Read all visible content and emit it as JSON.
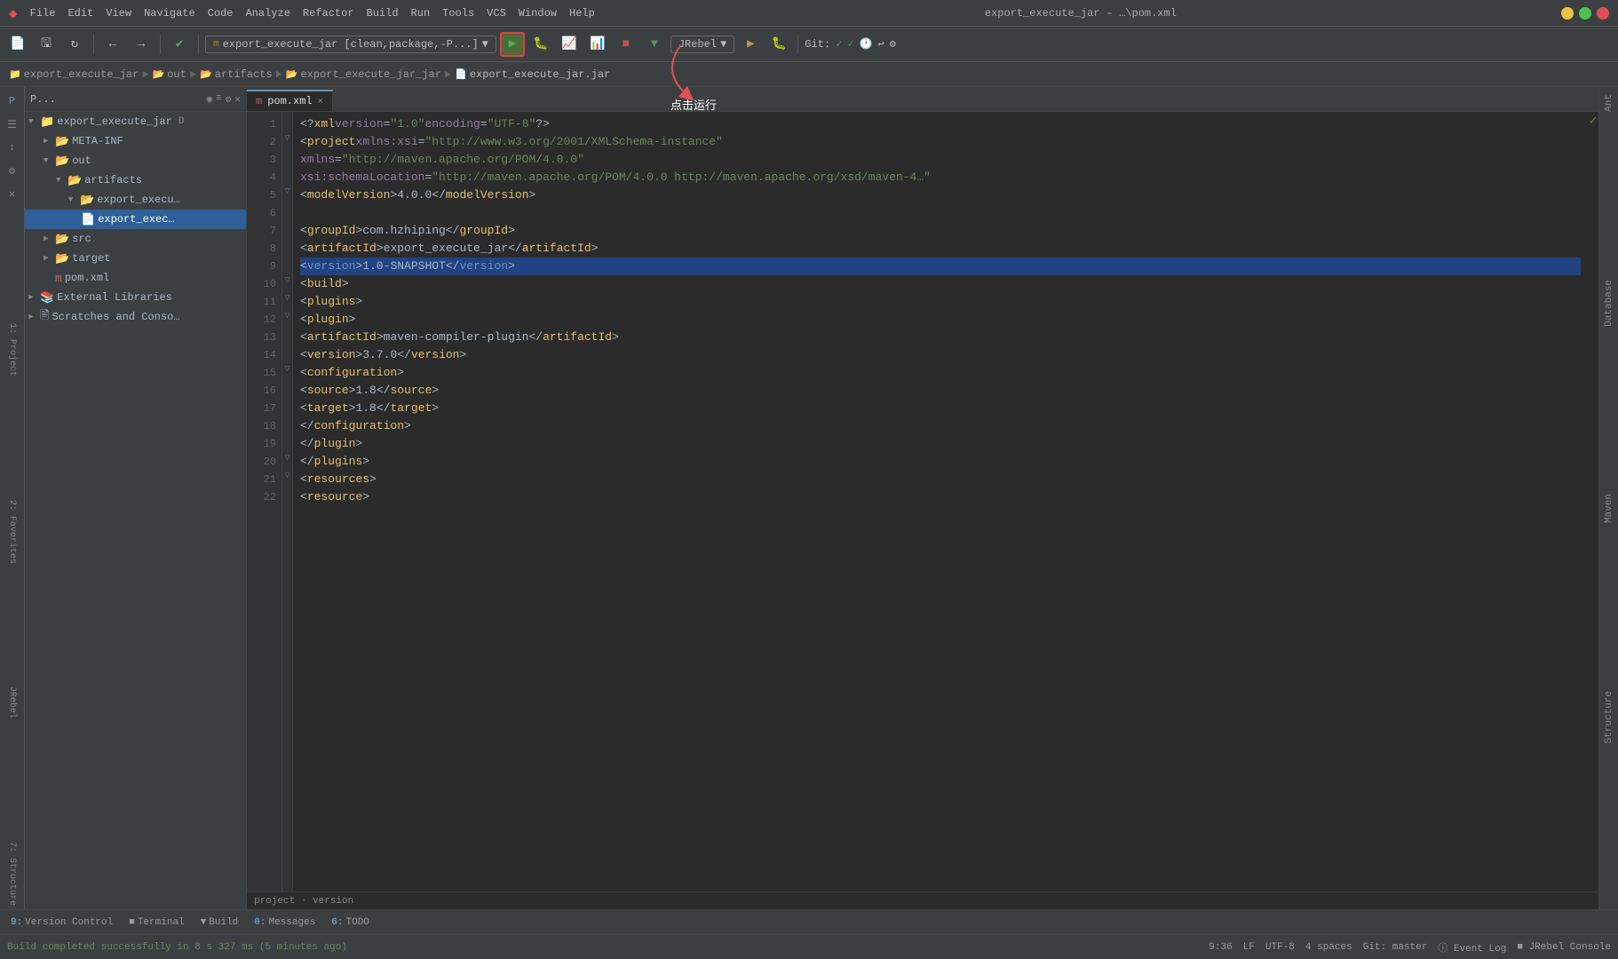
{
  "titleBar": {
    "title": "export_execute_jar – …\\pom.xml",
    "menus": [
      "File",
      "Edit",
      "View",
      "Navigate",
      "Code",
      "Analyze",
      "Refactor",
      "Build",
      "Run",
      "Tools",
      "VCS",
      "Window",
      "Help"
    ]
  },
  "toolbar": {
    "runConfig": "export_execute_jar [clean,package,-P...]",
    "jrebel": "JRebel",
    "git": "Git:"
  },
  "breadcrumb": {
    "items": [
      "export_execute_jar",
      "out",
      "artifacts",
      "export_execute_jar_jar",
      "export_execute_jar.jar"
    ]
  },
  "projectPanel": {
    "title": "P...",
    "rootName": "export_execute_jar",
    "items": [
      {
        "label": "export_execute_jar",
        "type": "project",
        "level": 0,
        "expanded": true
      },
      {
        "label": "META-INF",
        "type": "folder",
        "level": 1,
        "expanded": false
      },
      {
        "label": "out",
        "type": "folder-open",
        "level": 1,
        "expanded": true
      },
      {
        "label": "artifacts",
        "type": "folder-open",
        "level": 2,
        "expanded": true
      },
      {
        "label": "export_execu…",
        "type": "folder-open",
        "level": 3,
        "expanded": true
      },
      {
        "label": "export_exec…",
        "type": "jar",
        "level": 4,
        "selected": true
      },
      {
        "label": "src",
        "type": "folder",
        "level": 1,
        "expanded": false
      },
      {
        "label": "target",
        "type": "folder",
        "level": 1,
        "expanded": false
      },
      {
        "label": "pom.xml",
        "type": "pom",
        "level": 1
      },
      {
        "label": "External Libraries",
        "type": "ext-lib",
        "level": 0
      },
      {
        "label": "Scratches and Conso…",
        "type": "scratch",
        "level": 0
      }
    ]
  },
  "editor": {
    "tab": "pom.xml",
    "lines": [
      {
        "num": 1,
        "code": "<?xml version=\"1.0\" encoding=\"UTF-8\"?>",
        "parts": [
          {
            "t": "bracket",
            "v": "<?"
          },
          {
            "t": "tag",
            "v": "xml"
          },
          {
            "t": "attr",
            "v": " version"
          },
          {
            "t": "bracket",
            "v": "="
          },
          {
            "t": "string",
            "v": "\"1.0\""
          },
          {
            "t": "attr",
            "v": " encoding"
          },
          {
            "t": "bracket",
            "v": "="
          },
          {
            "t": "string",
            "v": "\"UTF-8\""
          },
          {
            "t": "bracket",
            "v": "?>"
          }
        ]
      },
      {
        "num": 2,
        "code": "<project xmlns:xsi=\"http://www.w3.org/2001/XMLSchema-instance\"",
        "parts": [
          {
            "t": "bracket",
            "v": "<"
          },
          {
            "t": "tag",
            "v": "project"
          },
          {
            "t": "attr",
            "v": " xmlns:xsi"
          },
          {
            "t": "bracket",
            "v": "="
          },
          {
            "t": "string",
            "v": "\"http://www.w3.org/2001/XMLSchema-instance\""
          }
        ]
      },
      {
        "num": 3,
        "code": "        xmlns=\"http://maven.apache.org/POM/4.0.0\"",
        "indent": 8,
        "parts": [
          {
            "t": "attr",
            "v": "        xmlns"
          },
          {
            "t": "bracket",
            "v": "="
          },
          {
            "t": "string",
            "v": "\"http://maven.apache.org/POM/4.0.0\""
          }
        ]
      },
      {
        "num": 4,
        "code": "        xsi:schemaLocation=\"http://maven.apache.org/POM/4.0.0 http://maven.apache.org/xsd/maven-4...",
        "parts": [
          {
            "t": "attr",
            "v": "        xsi:schemaLocation"
          },
          {
            "t": "bracket",
            "v": "="
          },
          {
            "t": "string",
            "v": "\"http://maven.apache.org/POM/4.0.0 http://maven.apache.org/xsd/maven-4…\""
          }
        ]
      },
      {
        "num": 5,
        "code": "    <modelVersion>4.0.0</modelVersion>",
        "parts": [
          {
            "t": "text",
            "v": "    "
          },
          {
            "t": "bracket",
            "v": "<"
          },
          {
            "t": "tag",
            "v": "modelVersion"
          },
          {
            "t": "bracket",
            "v": ">"
          },
          {
            "t": "text",
            "v": "4.0.0"
          },
          {
            "t": "bracket",
            "v": "</"
          },
          {
            "t": "tag",
            "v": "modelVersion"
          },
          {
            "t": "bracket",
            "v": ">"
          }
        ]
      },
      {
        "num": 6,
        "code": "",
        "parts": []
      },
      {
        "num": 7,
        "code": "    <groupId>com.hzhiping</groupId>",
        "parts": [
          {
            "t": "text",
            "v": "    "
          },
          {
            "t": "bracket",
            "v": "<"
          },
          {
            "t": "tag",
            "v": "groupId"
          },
          {
            "t": "bracket",
            "v": ">"
          },
          {
            "t": "text",
            "v": "com.hzhiping"
          },
          {
            "t": "bracket",
            "v": "</"
          },
          {
            "t": "tag",
            "v": "groupId"
          },
          {
            "t": "bracket",
            "v": ">"
          }
        ]
      },
      {
        "num": 8,
        "code": "    <artifactId>export_execute_jar</artifactId>",
        "parts": [
          {
            "t": "text",
            "v": "    "
          },
          {
            "t": "bracket",
            "v": "<"
          },
          {
            "t": "tag",
            "v": "artifactId"
          },
          {
            "t": "bracket",
            "v": ">"
          },
          {
            "t": "text",
            "v": "export_execute_jar"
          },
          {
            "t": "bracket",
            "v": "</"
          },
          {
            "t": "tag",
            "v": "artifactId"
          },
          {
            "t": "bracket",
            "v": ">"
          }
        ]
      },
      {
        "num": 9,
        "code": "    <version>1.0-SNAPSHOT</version>",
        "highlight": true,
        "parts": [
          {
            "t": "text",
            "v": "    "
          },
          {
            "t": "bracket",
            "v": "<"
          },
          {
            "t": "version-tag",
            "v": "version"
          },
          {
            "t": "bracket",
            "v": ">"
          },
          {
            "t": "text",
            "v": "1.0-SNAPSHOT"
          },
          {
            "t": "bracket",
            "v": "</"
          },
          {
            "t": "version-tag",
            "v": "version"
          },
          {
            "t": "bracket",
            "v": ">"
          }
        ]
      },
      {
        "num": 10,
        "code": "    <build>",
        "parts": [
          {
            "t": "text",
            "v": "    "
          },
          {
            "t": "bracket",
            "v": "<"
          },
          {
            "t": "tag",
            "v": "build"
          },
          {
            "t": "bracket",
            "v": ">"
          }
        ]
      },
      {
        "num": 11,
        "code": "        <plugins>",
        "parts": [
          {
            "t": "text",
            "v": "        "
          },
          {
            "t": "bracket",
            "v": "<"
          },
          {
            "t": "tag",
            "v": "plugins"
          },
          {
            "t": "bracket",
            "v": ">"
          }
        ]
      },
      {
        "num": 12,
        "code": "            <plugin>",
        "parts": [
          {
            "t": "text",
            "v": "            "
          },
          {
            "t": "bracket",
            "v": "<"
          },
          {
            "t": "tag",
            "v": "plugin"
          },
          {
            "t": "bracket",
            "v": ">"
          }
        ]
      },
      {
        "num": 13,
        "code": "                <artifactId>maven-compiler-plugin</artifactId>",
        "parts": [
          {
            "t": "text",
            "v": "                "
          },
          {
            "t": "bracket",
            "v": "<"
          },
          {
            "t": "tag",
            "v": "artifactId"
          },
          {
            "t": "bracket",
            "v": ">"
          },
          {
            "t": "text",
            "v": "maven-compiler-plugin"
          },
          {
            "t": "bracket",
            "v": "</"
          },
          {
            "t": "tag",
            "v": "artifactId"
          },
          {
            "t": "bracket",
            "v": ">"
          }
        ]
      },
      {
        "num": 14,
        "code": "                <version>3.7.0</version>",
        "parts": [
          {
            "t": "text",
            "v": "                "
          },
          {
            "t": "bracket",
            "v": "<"
          },
          {
            "t": "tag",
            "v": "version"
          },
          {
            "t": "bracket",
            "v": ">"
          },
          {
            "t": "text",
            "v": "3.7.0"
          },
          {
            "t": "bracket",
            "v": "</"
          },
          {
            "t": "tag",
            "v": "version"
          },
          {
            "t": "bracket",
            "v": ">"
          }
        ]
      },
      {
        "num": 15,
        "code": "                <configuration>",
        "parts": [
          {
            "t": "text",
            "v": "                "
          },
          {
            "t": "bracket",
            "v": "<"
          },
          {
            "t": "tag",
            "v": "configuration"
          },
          {
            "t": "bracket",
            "v": ">"
          }
        ]
      },
      {
        "num": 16,
        "code": "                    <source>1.8</source>",
        "parts": [
          {
            "t": "text",
            "v": "                    "
          },
          {
            "t": "bracket",
            "v": "<"
          },
          {
            "t": "tag",
            "v": "source"
          },
          {
            "t": "bracket",
            "v": ">"
          },
          {
            "t": "text",
            "v": "1.8"
          },
          {
            "t": "bracket",
            "v": "</"
          },
          {
            "t": "tag",
            "v": "source"
          },
          {
            "t": "bracket",
            "v": ">"
          }
        ]
      },
      {
        "num": 17,
        "code": "                    <target>1.8</target>",
        "parts": [
          {
            "t": "text",
            "v": "                    "
          },
          {
            "t": "bracket",
            "v": "<"
          },
          {
            "t": "tag",
            "v": "target"
          },
          {
            "t": "bracket",
            "v": ">"
          },
          {
            "t": "text",
            "v": "1.8"
          },
          {
            "t": "bracket",
            "v": "</"
          },
          {
            "t": "tag",
            "v": "target"
          },
          {
            "t": "bracket",
            "v": ">"
          }
        ]
      },
      {
        "num": 18,
        "code": "                </configuration>",
        "parts": [
          {
            "t": "text",
            "v": "                "
          },
          {
            "t": "bracket",
            "v": "</"
          },
          {
            "t": "tag",
            "v": "configuration"
          },
          {
            "t": "bracket",
            "v": ">"
          }
        ]
      },
      {
        "num": 19,
        "code": "            </plugin>",
        "parts": [
          {
            "t": "text",
            "v": "            "
          },
          {
            "t": "bracket",
            "v": "</"
          },
          {
            "t": "tag",
            "v": "plugin"
          },
          {
            "t": "bracket",
            "v": ">"
          }
        ]
      },
      {
        "num": 20,
        "code": "        </plugins>",
        "parts": [
          {
            "t": "text",
            "v": "        "
          },
          {
            "t": "bracket",
            "v": "</"
          },
          {
            "t": "tag",
            "v": "plugins"
          },
          {
            "t": "bracket",
            "v": ">"
          }
        ]
      },
      {
        "num": 21,
        "code": "        <resources>",
        "parts": [
          {
            "t": "text",
            "v": "        "
          },
          {
            "t": "bracket",
            "v": "<"
          },
          {
            "t": "tag",
            "v": "resources"
          },
          {
            "t": "bracket",
            "v": ">"
          }
        ]
      },
      {
        "num": 22,
        "code": "            <resource>",
        "parts": [
          {
            "t": "text",
            "v": "            "
          },
          {
            "t": "bracket",
            "v": "<"
          },
          {
            "t": "tag",
            "v": "resource"
          },
          {
            "t": "bracket",
            "v": ">"
          }
        ]
      }
    ],
    "pathBar": "project · version"
  },
  "annotation": {
    "text": "点击运行"
  },
  "bottomTabs": [
    {
      "num": "9",
      "label": "Version Control"
    },
    {
      "num": "",
      "label": "Terminal"
    },
    {
      "num": "",
      "label": "Build"
    },
    {
      "num": "0",
      "label": "Messages"
    },
    {
      "num": "6",
      "label": "TODO"
    }
  ],
  "statusBar": {
    "buildMessage": "Build completed successfully in 8 s 327 ms (5 minutes ago)",
    "line": "9:36",
    "encoding": "LF",
    "charset": "UTF-8",
    "indent": "4 spaces",
    "git": "Git: master",
    "eventLog": "Event Log",
    "jrebel": "JRebel Console"
  },
  "rightSidebar": {
    "items": [
      "Ant",
      "Database",
      "Maven",
      "Structure",
      "Favorites",
      "JRebel"
    ]
  }
}
